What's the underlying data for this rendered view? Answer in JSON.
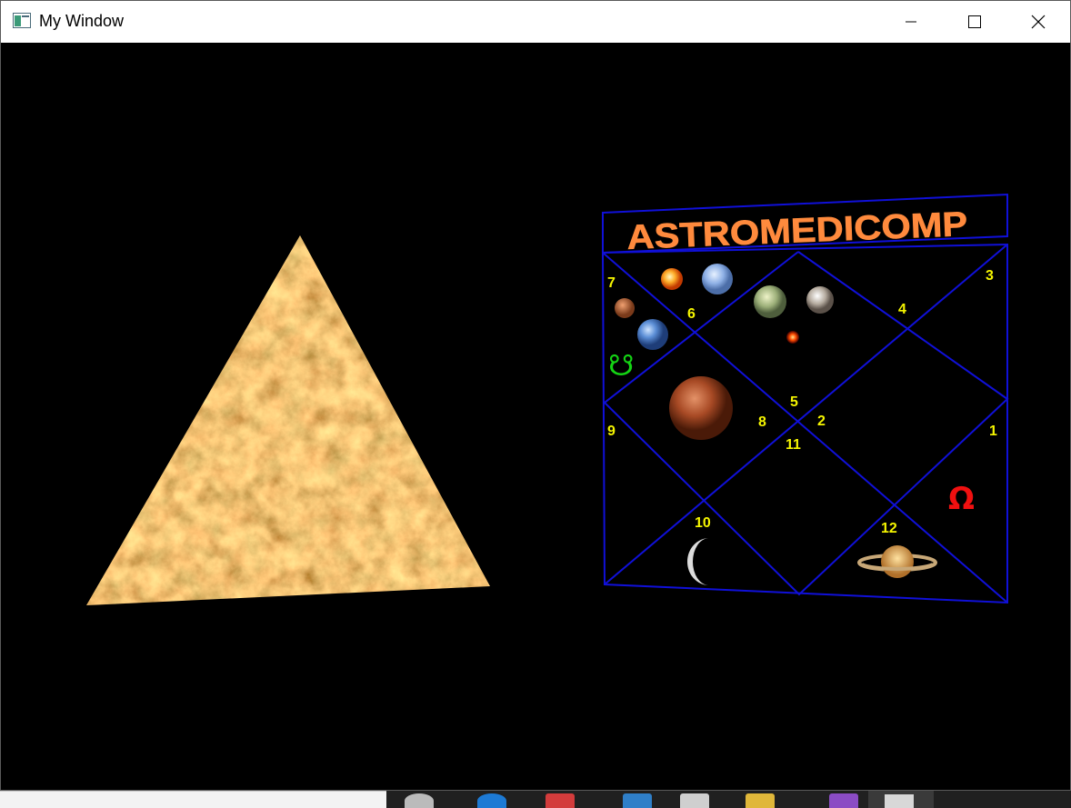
{
  "window": {
    "title": "My Window",
    "controls": {
      "minimize": "minimize-icon",
      "maximize": "maximize-icon",
      "close": "close-icon"
    }
  },
  "scene": {
    "pyramid": {
      "texture": "marble-rock",
      "colors": [
        "#c9853f",
        "#e0b46f",
        "#8a4f22",
        "#f1d7a4"
      ]
    },
    "chart": {
      "heading": "ASTROMEDICOMP",
      "heading_color": "#ff8a3d",
      "frame_color": "#1010d8",
      "number_color": "#f5f500",
      "houses": [
        "7",
        "6",
        "3",
        "4",
        "5",
        "8",
        "2",
        "9",
        "11",
        "1",
        "10",
        "12"
      ],
      "symbols": {
        "south_node": "☋",
        "omega": "Ω"
      },
      "planets": [
        "sun",
        "neptune",
        "jupiter",
        "moon-rock",
        "mars-small",
        "earth",
        "red-star",
        "mars",
        "crescent-moon",
        "saturn"
      ]
    }
  },
  "taskbar": {
    "icons": [
      "search-icon",
      "edge-icon",
      "vscode-icon",
      "app-red-icon",
      "azure-icon",
      "window-icon",
      "folder-icon",
      "vs-icon",
      "active-window-icon"
    ]
  }
}
